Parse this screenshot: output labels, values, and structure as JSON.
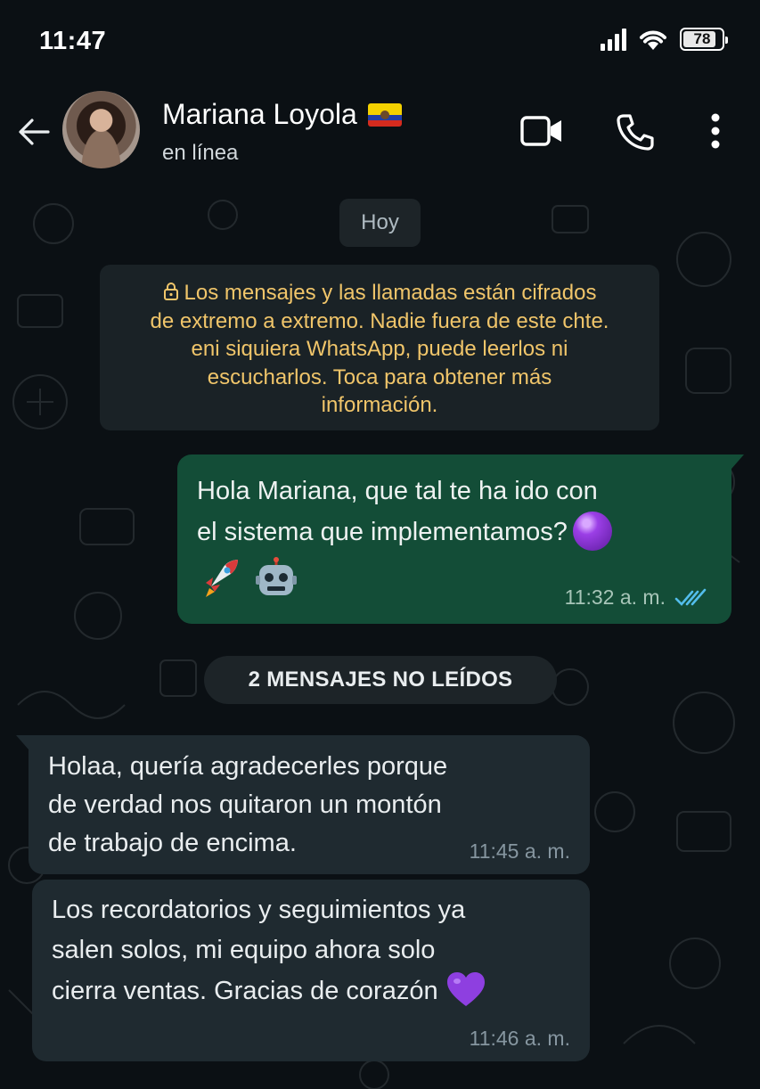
{
  "status_bar": {
    "time": "11:47",
    "battery": "78"
  },
  "header": {
    "contact_name": "Mariana Loyola",
    "flag": "ecuador-flag",
    "status": "en línea",
    "icons": [
      "back-arrow-icon",
      "video-call-icon",
      "voice-call-icon",
      "more-options-icon"
    ]
  },
  "chat": {
    "date_chip": "Hoy",
    "encryption_notice": "Los mensajes y las llamadas están cifrados de extremo a extremo. Nadie fuera de este chte. eni siquiera WhatsApp, puede leerlos ni escucharlos. Toca para obtener más información.",
    "encryption_lines": [
      "Los mensajes y las llamadas están cifrados",
      "de extremo a extremo. Nadie fuera de este chte.",
      "eni siquiera WhatsApp, puede leerlos ni",
      "escucharlos. Toca para obtener más",
      "información."
    ],
    "outgoing": {
      "line1": "Hola Mariana, que tal te ha ido con",
      "line2": "el sistema que implementamos?",
      "emojis": [
        "purple-circle",
        "rocket",
        "robot"
      ],
      "time": "11:32 a. m.",
      "read_status": "read"
    },
    "unread_divider": "2 MENSAJES NO LEÍDOS",
    "incoming": [
      {
        "lines": [
          "Holaa, quería agradecerles porque",
          "de verdad nos quitaron un montón",
          "de trabajo de encima."
        ],
        "time": "11:45 a. m."
      },
      {
        "lines": [
          "Los recordatorios y seguimientos ya",
          "salen solos, mi equipo ahora solo",
          "cierra ventas. Gracias de corazón"
        ],
        "emoji": "purple-heart",
        "time": "11:46 a. m."
      }
    ]
  },
  "colors": {
    "background": "#0b1014",
    "outgoing_bubble": "#134d37",
    "incoming_bubble": "#1f2a30",
    "system_text": "#f0c56a",
    "read_ticks": "#53bdeb"
  }
}
